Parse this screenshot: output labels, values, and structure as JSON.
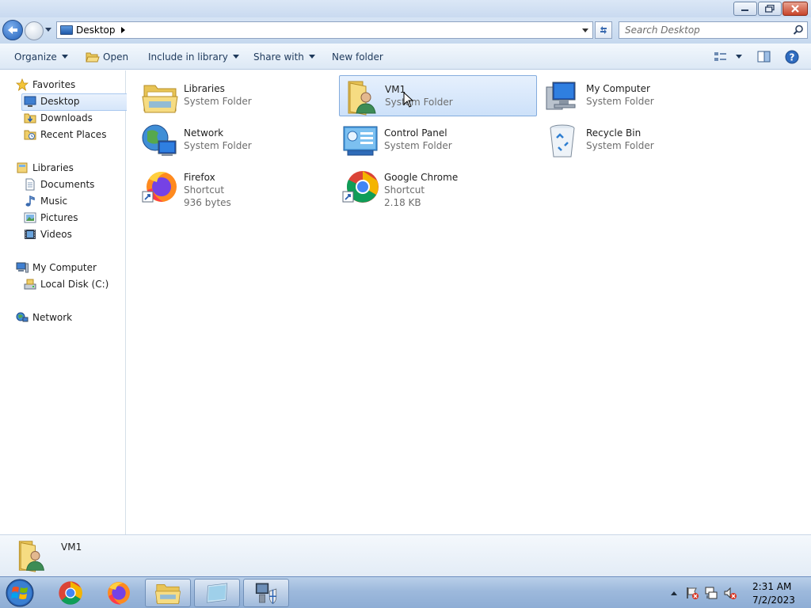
{
  "window": {
    "controls": {
      "minimize": "minimize-icon",
      "maximize": "restore-icon",
      "close": "close-icon"
    }
  },
  "address": {
    "crumb": "Desktop"
  },
  "search": {
    "placeholder": "Search Desktop"
  },
  "toolbar": {
    "organize": "Organize",
    "open": "Open",
    "include": "Include in library",
    "share": "Share with",
    "new_folder": "New folder"
  },
  "nav": {
    "favorites": "Favorites",
    "desktop": "Desktop",
    "downloads": "Downloads",
    "recent": "Recent Places",
    "libraries": "Libraries",
    "documents": "Documents",
    "music": "Music",
    "pictures": "Pictures",
    "videos": "Videos",
    "computer": "My Computer",
    "local_disk": "Local Disk (C:)",
    "network": "Network"
  },
  "items": [
    {
      "name": "Libraries",
      "line2": "System Folder",
      "line3": ""
    },
    {
      "name": "VM1",
      "line2": "System Folder",
      "line3": ""
    },
    {
      "name": "My Computer",
      "line2": "System Folder",
      "line3": ""
    },
    {
      "name": "Network",
      "line2": "System Folder",
      "line3": ""
    },
    {
      "name": "Control Panel",
      "line2": "System Folder",
      "line3": ""
    },
    {
      "name": "Recycle Bin",
      "line2": "System Folder",
      "line3": ""
    },
    {
      "name": "Firefox",
      "line2": "Shortcut",
      "line3": "936 bytes"
    },
    {
      "name": "Google Chrome",
      "line2": "Shortcut",
      "line3": "2.18 KB"
    }
  ],
  "selected_item": "VM1",
  "details": {
    "name": "VM1"
  },
  "taskbar": {
    "clock_time": "2:31 AM",
    "clock_date": "7/2/2023"
  },
  "colors": {
    "selection_border": "#84acdd",
    "selection_fill": "#cde1f9",
    "toolbar_text": "#1e395b",
    "secondary_text": "#6d6d6d"
  }
}
